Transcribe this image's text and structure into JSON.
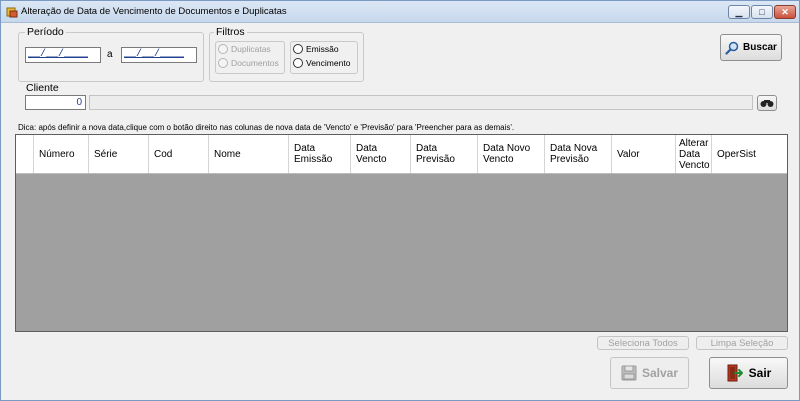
{
  "window": {
    "title": "Alteração de Data de Vencimento de Documentos e Duplicatas",
    "min_symbol": "▁",
    "max_symbol": "□",
    "close_symbol": "✕"
  },
  "periodo": {
    "label": "Período",
    "start_value": "__/__/____",
    "separator": "a",
    "end_value": "__/__/____"
  },
  "filtros": {
    "label": "Filtros",
    "tipo_options": [
      "Duplicatas",
      "Documentos"
    ],
    "data_options": [
      "Emissão",
      "Vencimento"
    ]
  },
  "buscar_label": "Buscar",
  "cliente": {
    "label": "Cliente",
    "code_value": "0",
    "name_value": ""
  },
  "hint": "Dica: após definir a nova data,clique com o botão direito nas colunas de nova data de 'Vencto' e 'Previsão' para 'Preencher para as demais'.",
  "grid": {
    "columns": [
      "Número",
      "Série",
      "Cod",
      "Nome",
      "Data\nEmissão",
      "Data\nVencto",
      "Data\nPrevisão",
      "Data Novo\nVencto",
      "Data Nova\nPrevisão",
      "Valor",
      "Alterar\nData\nVencto",
      "OperSist"
    ]
  },
  "actions": {
    "seleciona_todos": "Seleciona Todos",
    "limpa_selecao": "Limpa Seleção",
    "salvar": "Salvar",
    "sair": "Sair"
  },
  "icons": {
    "search": "magnifier-icon",
    "lookup": "binoculars-icon",
    "save": "floppy-disk-icon",
    "exit": "exit-door-icon"
  }
}
